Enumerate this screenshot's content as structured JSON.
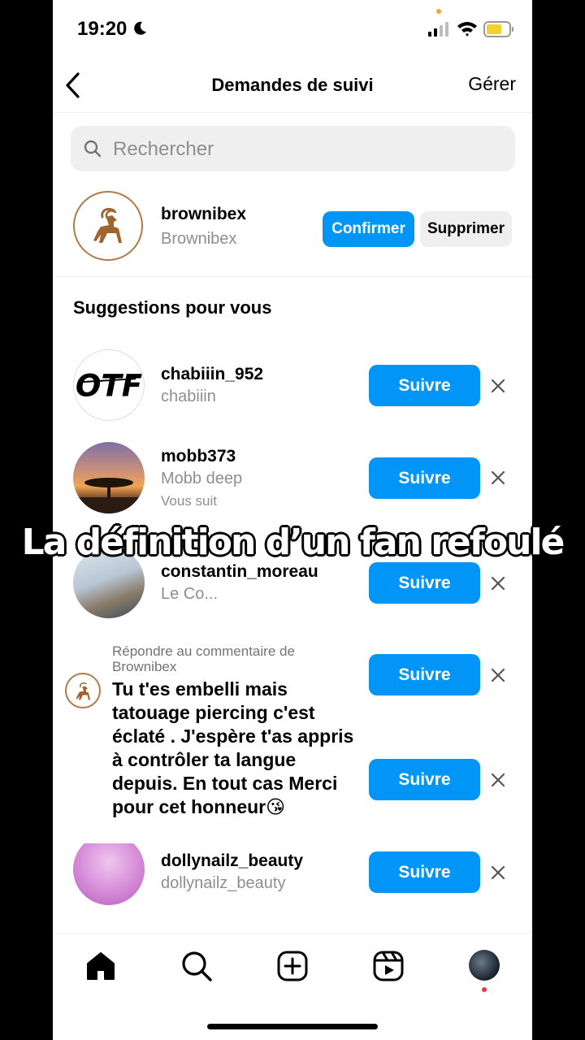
{
  "status_bar": {
    "time": "19:20"
  },
  "header": {
    "title": "Demandes de suivi",
    "manage": "Gérer"
  },
  "search": {
    "placeholder": "Rechercher"
  },
  "request": {
    "username": "brownibex",
    "name": "Brownibex",
    "confirm_label": "Confirmer",
    "delete_label": "Supprimer"
  },
  "suggestions_title": "Suggestions pour vous",
  "suggestions": [
    {
      "username": "chabiiin_952",
      "name": "chabiiin",
      "note": "",
      "follow_label": "Suivre"
    },
    {
      "username": "mobb373",
      "name": "Mobb deep",
      "note": "Vous suit",
      "follow_label": "Suivre"
    },
    {
      "username": "constantin_moreau",
      "name": "Le Co...",
      "note": "",
      "follow_label": "Suivre"
    },
    {
      "username": "",
      "name": "",
      "note": "",
      "follow_label": "Suivre"
    },
    {
      "username": "",
      "name": "",
      "note": "",
      "follow_label": "Suivre"
    },
    {
      "username": "dollynailz_beauty",
      "name": "dollynailz_beauty",
      "note": "",
      "follow_label": "Suivre"
    }
  ],
  "caption": "La définition d’un fan refoulé",
  "reply": {
    "label": "Répondre au commentaire de Brownibex",
    "text": "Tu t'es embelli mais tatouage piercing c'est éclaté . J'espère t'as appris à contrôler ta langue depuis. En tout cas Merci pour cet honneur😘"
  },
  "colors": {
    "accent": "#0095f6",
    "secondary_text": "#8e8e8e",
    "button_gray": "#efefef"
  },
  "icons": [
    "back-icon",
    "search-icon",
    "close-icon",
    "home-icon",
    "explore-icon",
    "create-icon",
    "reels-icon"
  ]
}
